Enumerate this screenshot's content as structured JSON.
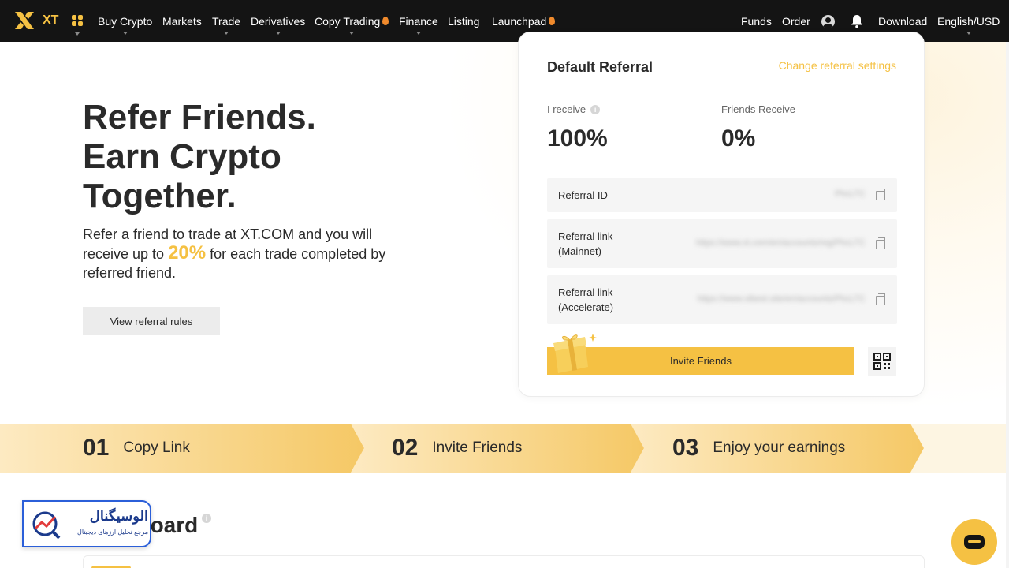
{
  "nav": {
    "logo_text": "XT",
    "items": [
      {
        "label": "Buy Crypto",
        "hot": false
      },
      {
        "label": "Markets",
        "hot": false
      },
      {
        "label": "Trade",
        "hot": false
      },
      {
        "label": "Derivatives",
        "hot": false
      },
      {
        "label": "Copy Trading",
        "hot": true
      },
      {
        "label": "Finance",
        "hot": false
      },
      {
        "label": "Listing",
        "hot": false
      },
      {
        "label": "Launchpad",
        "hot": true
      }
    ],
    "right": {
      "funds": "Funds",
      "order": "Order",
      "download": "Download",
      "language": "English/USD"
    }
  },
  "hero": {
    "title_lines": [
      "Refer Friends.",
      "Earn Crypto",
      "Together."
    ],
    "desc_before": "Refer a friend to trade at XT.COM and you will receive up to ",
    "desc_pct": "20%",
    "desc_after": " for each trade completed by referred friend.",
    "rules_button": "View referral rules"
  },
  "card": {
    "title": "Default Referral",
    "change_link": "Change referral settings",
    "i_receive_label": "I receive",
    "i_receive_value": "100%",
    "friends_receive_label": "Friends Receive",
    "friends_receive_value": "0%",
    "rows": [
      {
        "label": "Referral ID",
        "value": "PhcLTC"
      },
      {
        "label": "Referral link (Mainnet)",
        "value": "https://www.xt.com/en/accounts/reg/PhcLTC"
      },
      {
        "label": "Referral link (Accelerate)",
        "value": "https://www.xtbest.site/en/accounts/PhcLTC"
      }
    ],
    "invite_button": "Invite Friends"
  },
  "steps": [
    {
      "num": "01",
      "label": "Copy Link"
    },
    {
      "num": "02",
      "label": "Invite Friends"
    },
    {
      "num": "03",
      "label": "Enjoy your earnings"
    }
  ],
  "dashboard": {
    "title": "Dashboard"
  },
  "watermark": {
    "title": "الوسیگنال",
    "subtitle": "مرجع تحلیل ارزهای دیجیتال"
  },
  "colors": {
    "brand": "#f5c143",
    "nav_bg": "#141414",
    "step_band": "#fbe2a8"
  }
}
